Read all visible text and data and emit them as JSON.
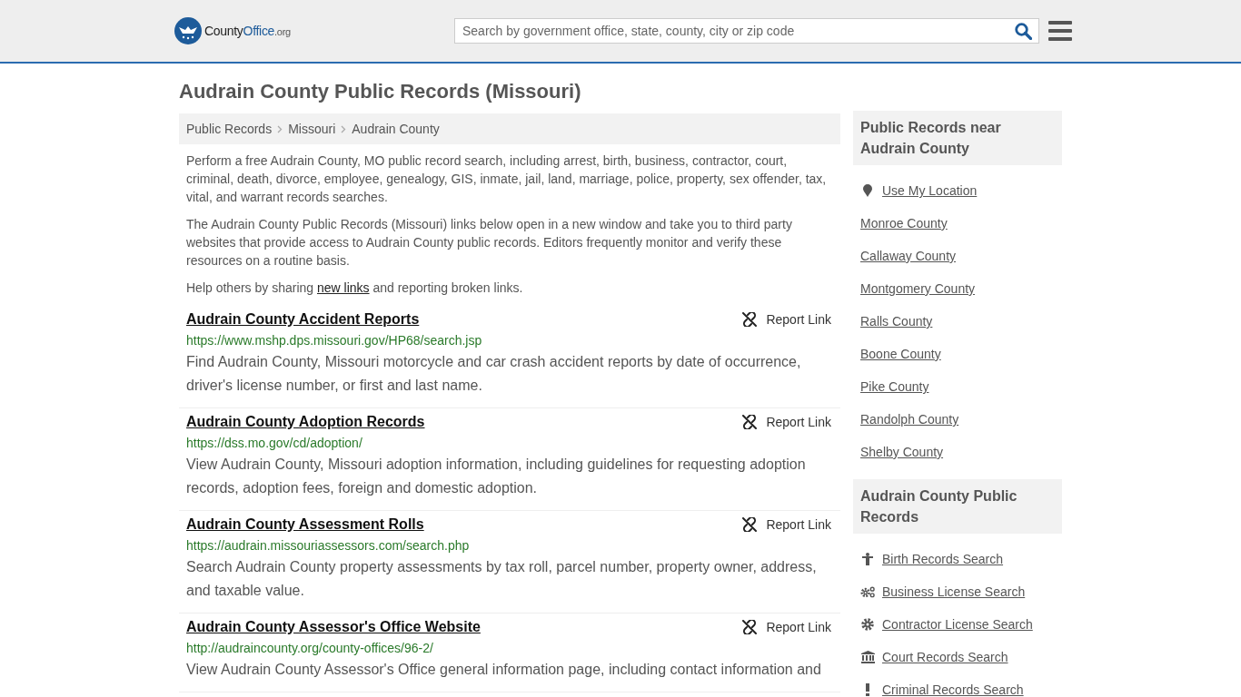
{
  "header": {
    "logo": {
      "part_1": "County",
      "part_2": "Office",
      "part_3": ".org"
    },
    "search": {
      "placeholder": "Search by government office, state, county, city or zip code"
    }
  },
  "title": "Audrain County Public Records (Missouri)",
  "breadcrumbs": [
    "Public Records",
    "Missouri",
    "Audrain County"
  ],
  "intro": [
    "Perform a free Audrain County, MO public record search, including arrest, birth, business, contractor, court, criminal, death, divorce, employee, genealogy, GIS, inmate, jail, land, marriage, police, property, sex offender, tax, vital, and warrant records searches.",
    "The Audrain County Public Records (Missouri) links below open in a new window and take you to third party websites that provide access to Audrain County public records. Editors frequently monitor and verify these resources on a routine basis."
  ],
  "help": {
    "before": "Help others by sharing",
    "link": "new links",
    "after": "and reporting broken links."
  },
  "records": [
    {
      "title": "Audrain County Accident Reports",
      "url": "https://www.mshp.dps.missouri.gov/HP68/search.jsp",
      "description": "Find Audrain County, Missouri motorcycle and car crash accident reports by date of occurrence, driver's license number, or first and last name.",
      "report": "Report Link"
    },
    {
      "title": "Audrain County Adoption Records",
      "url": "https://dss.mo.gov/cd/adoption/",
      "description": "View Audrain County, Missouri adoption information, including guidelines for requesting adoption records, adoption fees, foreign and domestic adoption.",
      "report": "Report Link"
    },
    {
      "title": "Audrain County Assessment Rolls",
      "url": "https://audrain.missouriassessors.com/search.php",
      "description": "Search Audrain County property assessments by tax roll, parcel number, property owner, address, and taxable value.",
      "report": "Report Link"
    },
    {
      "title": "Audrain County Assessor's Office Website",
      "url": "http://audraincounty.org/county-offices/96-2/",
      "description": "View Audrain County Assessor's Office general information page, including contact information and",
      "report": "Report Link"
    }
  ],
  "sidebar": {
    "near": {
      "heading": "Public Records near Audrain County",
      "location": "Use My Location",
      "items": [
        "Monroe County",
        "Callaway County",
        "Montgomery County",
        "Ralls County",
        "Boone County",
        "Pike County",
        "Randolph County",
        "Shelby County"
      ]
    },
    "records": {
      "heading": "Audrain County Public Records",
      "items": [
        {
          "kind": "person",
          "label": "Birth Records Search"
        },
        {
          "kind": "gears",
          "label": "Business License Search"
        },
        {
          "kind": "gear",
          "label": "Contractor License Search"
        },
        {
          "kind": "bank",
          "label": "Court Records Search"
        },
        {
          "kind": "exclaim",
          "label": "Criminal Records Search"
        }
      ]
    }
  }
}
